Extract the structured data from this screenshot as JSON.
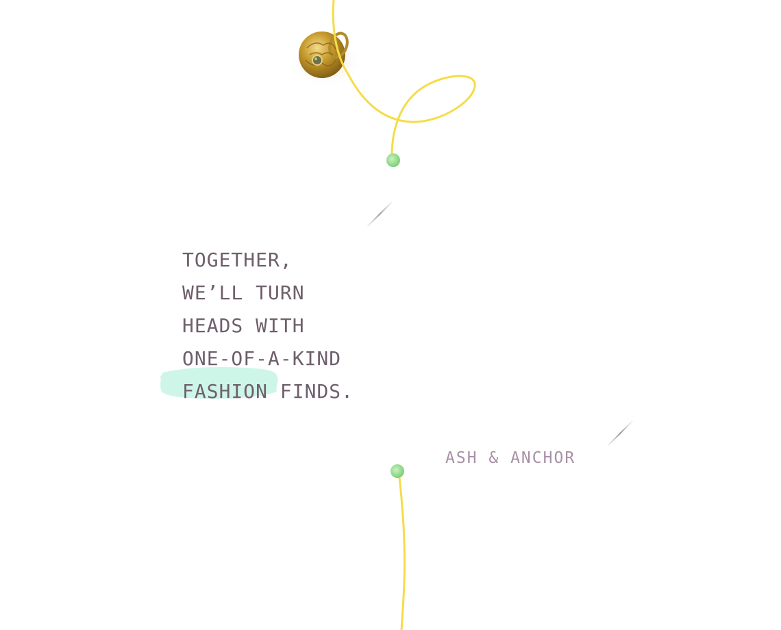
{
  "tagline": {
    "line1": "TOGETHER,",
    "line2": "WE’LL TURN",
    "line3": "HEADS WITH",
    "line4": "ONE-OF-A-KIND",
    "line5_highlight": "FASHION",
    "line5_rest": " FINDS."
  },
  "brand": {
    "name": "ASH & ANCHOR"
  },
  "colors": {
    "text": "#6e5f6b",
    "brand_text": "#a890a6",
    "thread": "#f5dc48",
    "bead": "#8fd88a",
    "highlight": "#c9f5e6",
    "ring_gold": "#c69a2c"
  },
  "icons": {
    "ring": "gold-ring-image",
    "thread": "yellow-thread",
    "bead": "green-bead",
    "needle": "needle-icon"
  }
}
